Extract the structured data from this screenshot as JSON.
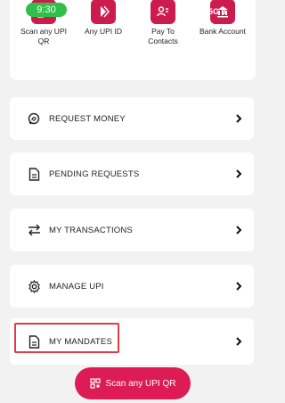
{
  "status_bar": {
    "time": "9:30",
    "right_text": "5G 8"
  },
  "quick_actions": [
    {
      "label": "Scan any UPI QR",
      "icon": "qr-scan-icon"
    },
    {
      "label": "Any UPI ID",
      "icon": "upi-logo-icon"
    },
    {
      "label": "Pay To Contacts",
      "icon": "contacts-icon"
    },
    {
      "label": "Bank Account",
      "icon": "bank-icon"
    }
  ],
  "menu": [
    {
      "label": "REQUEST MONEY",
      "icon": "request-money-icon"
    },
    {
      "label": "PENDING REQUESTS",
      "icon": "document-icon"
    },
    {
      "label": "MY TRANSACTIONS",
      "icon": "transfer-arrows-icon"
    },
    {
      "label": "MANAGE UPI",
      "icon": "gear-icon"
    },
    {
      "label": "MY MANDATES",
      "icon": "document-icon"
    }
  ],
  "fab": {
    "label": "Scan any UPI QR",
    "icon": "qr-code-icon"
  },
  "colors": {
    "accent": "#dd1b55",
    "highlight": "#e53945",
    "status_green": "#2fbf4a",
    "background": "#f2f2f2"
  }
}
